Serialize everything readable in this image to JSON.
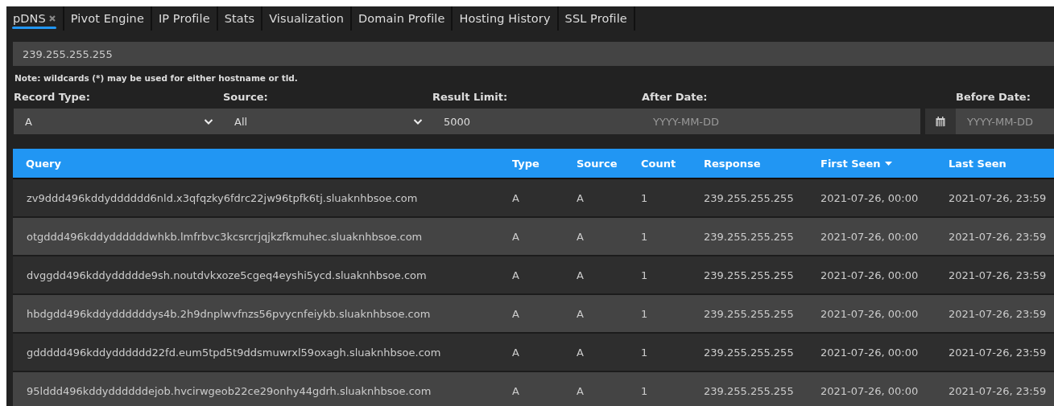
{
  "tabs": [
    {
      "label": "pDNS",
      "selected": true,
      "closable": true
    },
    {
      "label": "Pivot Engine",
      "selected": false,
      "closable": false
    },
    {
      "label": "IP Profile",
      "selected": false,
      "closable": false
    },
    {
      "label": "Stats",
      "selected": false,
      "closable": false
    },
    {
      "label": "Visualization",
      "selected": false,
      "closable": false
    },
    {
      "label": "Domain Profile",
      "selected": false,
      "closable": false
    },
    {
      "label": "Hosting History",
      "selected": false,
      "closable": false
    },
    {
      "label": "SSL Profile",
      "selected": false,
      "closable": false
    }
  ],
  "search": {
    "value": "239.255.255.255"
  },
  "note": "Note: wildcards (*) may be used for either hostname or tld.",
  "filters": [
    {
      "label": "Record Type:",
      "kind": "select",
      "value": "A"
    },
    {
      "label": "Source:",
      "kind": "select",
      "value": "All"
    },
    {
      "label": "Result Limit:",
      "kind": "input",
      "value": "5000"
    },
    {
      "label": "After Date:",
      "kind": "date",
      "placeholder": "YYYY-MM-DD",
      "calendar": true
    },
    {
      "label": "Before Date:",
      "kind": "date",
      "placeholder": "YYYY-MM-DD",
      "calendar": false
    }
  ],
  "table": {
    "columns": [
      {
        "label": "Query",
        "sorted": false
      },
      {
        "label": "Type",
        "sorted": false
      },
      {
        "label": "Source",
        "sorted": false
      },
      {
        "label": "Count",
        "sorted": false
      },
      {
        "label": "Response",
        "sorted": false
      },
      {
        "label": "First Seen",
        "sorted": true
      },
      {
        "label": "Last Seen",
        "sorted": false
      }
    ],
    "rows": [
      [
        "zv9ddd496kddydddddd6nld.x3qfqzky6fdrc22jw96tpfk6tj.sluaknhbsoe.com",
        "A",
        "A",
        "1",
        "239.255.255.255",
        "2021-07-26, 00:00",
        "2021-07-26, 23:59"
      ],
      [
        "otgddd496kddyddddddwhkb.lmfrbvc3kcsrcrjqjkzfkmuhec.sluaknhbsoe.com",
        "A",
        "A",
        "1",
        "239.255.255.255",
        "2021-07-26, 00:00",
        "2021-07-26, 23:59"
      ],
      [
        "dvggdd496kddyddddde9sh.noutdvkxoze5cgeq4eyshi5ycd.sluaknhbsoe.com",
        "A",
        "A",
        "1",
        "239.255.255.255",
        "2021-07-26, 00:00",
        "2021-07-26, 23:59"
      ],
      [
        "hbdgdd496kddyddddddys4b.2h9dnplwvfnzs56pvycnfeiykb.sluaknhbsoe.com",
        "A",
        "A",
        "1",
        "239.255.255.255",
        "2021-07-26, 00:00",
        "2021-07-26, 23:59"
      ],
      [
        "gddddd496kddydddddd22fd.eum5tpd5t9ddsmuwrxl59oxagh.sluaknhbsoe.com",
        "A",
        "A",
        "1",
        "239.255.255.255",
        "2021-07-26, 00:00",
        "2021-07-26, 23:59"
      ],
      [
        "95lddd496kddyddddddejob.hvcirwgeob22ce29onhy44gdrh.sluaknhbsoe.com",
        "A",
        "A",
        "1",
        "239.255.255.255",
        "2021-07-26, 00:00",
        "2021-07-26, 23:59"
      ]
    ]
  }
}
